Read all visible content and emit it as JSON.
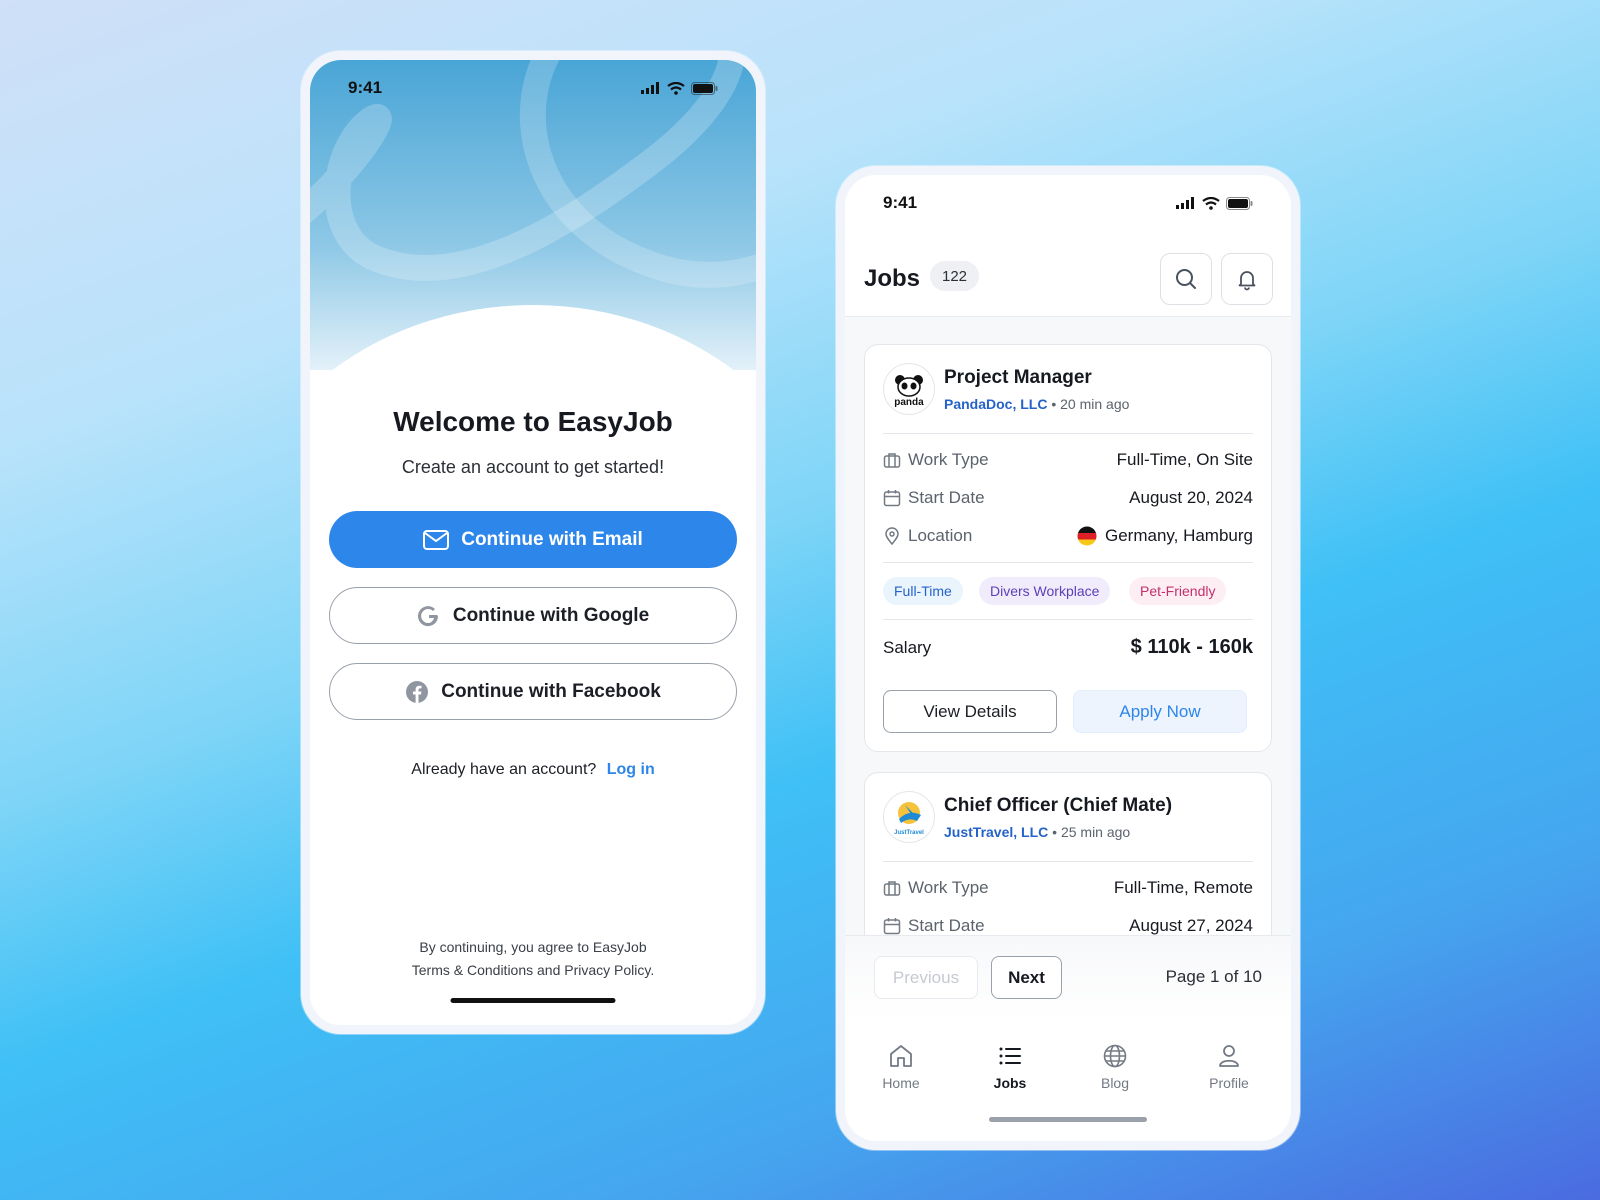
{
  "phone_login": {
    "status_time": "9:41",
    "title": "Welcome to EasyJob",
    "subtitle": "Create an account to get started!",
    "buttons": {
      "email": "Continue with Email",
      "google": "Continue with Google",
      "facebook": "Continue with Facebook"
    },
    "login_prompt": "Already have an account?",
    "login_link": "Log in",
    "terms_line1": "By continuing, you agree to EasyJob",
    "terms_line2": "Terms & Conditions and Privacy Policy."
  },
  "phone_jobs": {
    "status_time": "9:41",
    "header": {
      "title": "Jobs",
      "count": "122"
    },
    "jobs": [
      {
        "logo_text": "panda",
        "title": "Project Manager",
        "company": "PandaDoc, LLC",
        "posted": "• 20 min ago",
        "work_type_label": "Work Type",
        "work_type": "Full-Time, On Site",
        "start_date_label": "Start Date",
        "start_date": "August 20, 2024",
        "location_label": "Location",
        "location": "Germany, Hamburg",
        "tags": [
          "Full-Time",
          "Divers Workplace",
          "Pet-Friendly"
        ],
        "salary_label": "Salary",
        "salary": "$ 110k - 160k",
        "view_details": "View Details",
        "apply_now": "Apply Now"
      },
      {
        "logo_text": "JustTravel",
        "title": "Chief Officer (Chief Mate)",
        "company": "JustTravel, LLC",
        "posted": "• 25 min ago",
        "work_type_label": "Work Type",
        "work_type": "Full-Time, Remote",
        "start_date_label": "Start Date",
        "start_date": "August 27, 2024"
      }
    ],
    "pagination": {
      "previous": "Previous",
      "next": "Next",
      "page_info": "Page 1 of 10"
    },
    "tabs": [
      {
        "label": "Home",
        "icon": "home-icon"
      },
      {
        "label": "Jobs",
        "icon": "list-icon"
      },
      {
        "label": "Blog",
        "icon": "globe-icon"
      },
      {
        "label": "Profile",
        "icon": "user-icon"
      }
    ],
    "colors": {
      "primary": "#2d86ea",
      "tag_fulltime_bg": "#eaf4fc",
      "tag_fulltime_fg": "#2563c9",
      "tag_divers_bg": "#f1ecfb",
      "tag_divers_fg": "#5b3fb8",
      "tag_pet_bg": "#fdeef3",
      "tag_pet_fg": "#c2306b"
    }
  }
}
